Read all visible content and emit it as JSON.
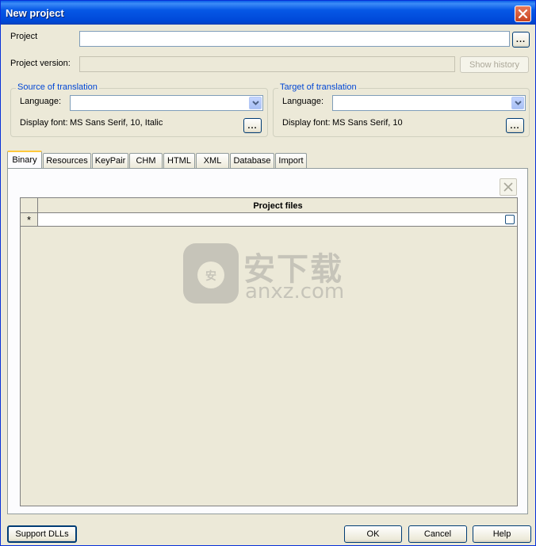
{
  "window": {
    "title": "New project"
  },
  "project": {
    "label": "Project",
    "value": "",
    "browse_label": "..."
  },
  "project_version": {
    "label": "Project version:",
    "value": "",
    "show_history_label": "Show history"
  },
  "source": {
    "group_title": "Source of translation",
    "language_label": "Language:",
    "language_value": "",
    "display_font_label": "Display font:",
    "display_font_value": "MS Sans Serif, 10, Italic",
    "font_button_label": "..."
  },
  "target": {
    "group_title": "Target of translation",
    "language_label": "Language:",
    "language_value": "",
    "display_font_label": "Display font:",
    "display_font_value": "MS Sans Serif, 10",
    "font_button_label": "..."
  },
  "tabs": [
    {
      "label": "Binary",
      "active": true
    },
    {
      "label": "Resources"
    },
    {
      "label": "KeyPair"
    },
    {
      "label": "CHM"
    },
    {
      "label": "HTML"
    },
    {
      "label": "XML"
    },
    {
      "label": "Database"
    },
    {
      "label": "Import"
    }
  ],
  "grid": {
    "column_header": "Project files",
    "new_row_marker": "*",
    "rows": []
  },
  "watermark": {
    "text_cn": "安下载",
    "text_en": "anxz.com"
  },
  "footer": {
    "support_dlls_label": "Support DLLs",
    "ok_label": "OK",
    "cancel_label": "Cancel",
    "help_label": "Help"
  },
  "colors": {
    "titlebar": "#0054e3",
    "dialog_bg": "#ece9d8",
    "group_title": "#0046d5",
    "tab_highlight": "#ffc83c"
  }
}
